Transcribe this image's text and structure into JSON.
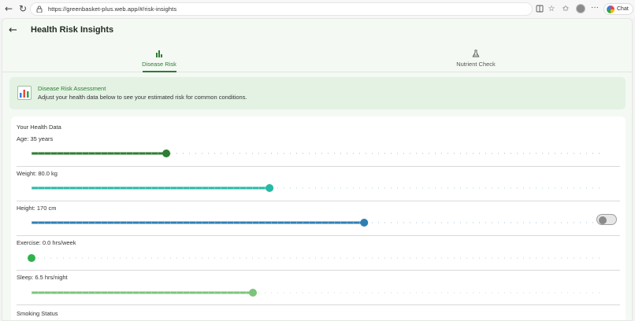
{
  "browser": {
    "url": "https://greenbasket-plus.web.app/#/risk-insights",
    "chat_label": "Chat",
    "icons": [
      "back-icon",
      "refresh-icon",
      "lock-icon",
      "reader-view-icon",
      "favorite-star-icon",
      "favorites-icon",
      "profile-avatar",
      "more-options-icon",
      "copilot-icon"
    ]
  },
  "header": {
    "title": "Health Risk Insights"
  },
  "tabs": [
    {
      "label": "Disease Risk",
      "icon": "bar-chart-icon",
      "active": true
    },
    {
      "label": "Nutrient Check",
      "icon": "flask-icon",
      "active": false
    }
  ],
  "banner": {
    "title": "Disease Risk Assessment",
    "description": "Adjust your health data below to see your estimated risk for common conditions.",
    "icon": "chart-icon"
  },
  "health_data": {
    "title": "Your Health Data",
    "fields": [
      {
        "label": "Age: 35 years",
        "value": 35,
        "color": "#2e7d32",
        "fill_fraction": 0.235
      },
      {
        "label": "Weight: 80.0 kg",
        "value": 80.0,
        "color": "#26b9a5",
        "fill_fraction": 0.415
      },
      {
        "label": "Height: 170 cm",
        "value": 170,
        "color": "#2f7fb5",
        "fill_fraction": 0.58
      },
      {
        "label": "Exercise: 0.0 hrs/week",
        "value": 0.0,
        "color": "#2fb24c",
        "fill_fraction": 0.0
      },
      {
        "label": "Sleep: 6.5 hrs/night",
        "value": 6.5,
        "color": "#7cc47c",
        "fill_fraction": 0.386
      }
    ],
    "smoking_label": "Smoking Status",
    "smoking_on": false
  },
  "colors": {
    "accent": "#2e7d32",
    "banner_bg": "#e3f2e3"
  }
}
